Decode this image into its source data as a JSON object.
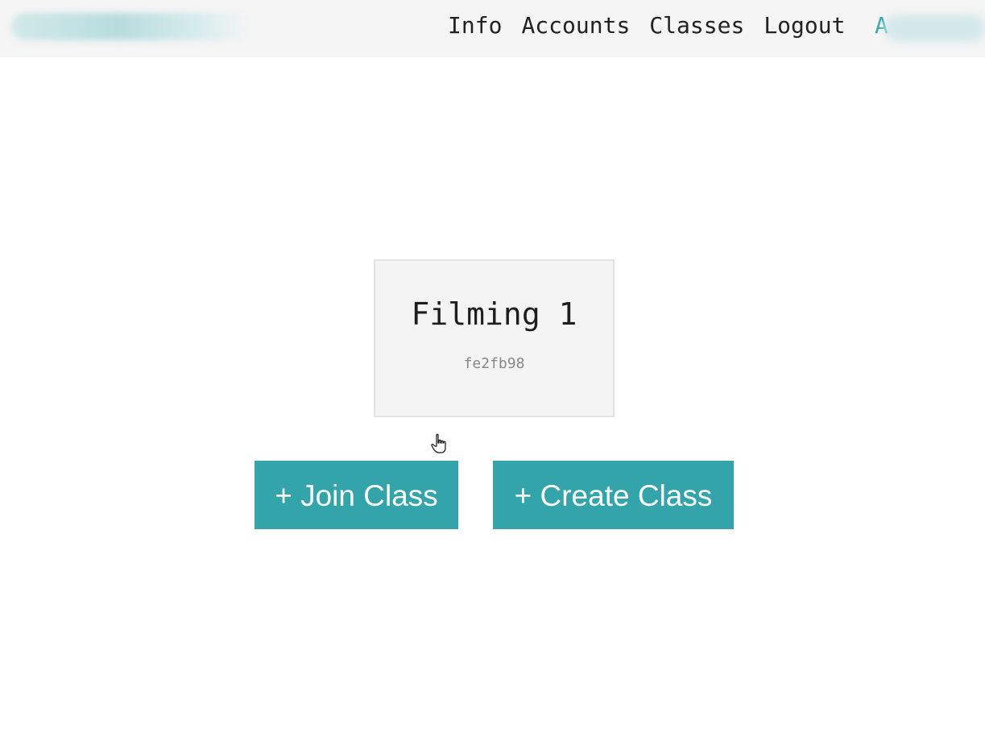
{
  "nav": {
    "links": [
      "Info",
      "Accounts",
      "Classes",
      "Logout"
    ],
    "user_initial": "A"
  },
  "class_card": {
    "name": "Filming 1",
    "code": "fe2fb98"
  },
  "buttons": {
    "join_label": "+ Join Class",
    "create_label": "+ Create Class"
  },
  "colors": {
    "accent": "#33a5aa",
    "navbar_bg": "#f5f5f5",
    "card_bg": "#f4f4f4"
  }
}
